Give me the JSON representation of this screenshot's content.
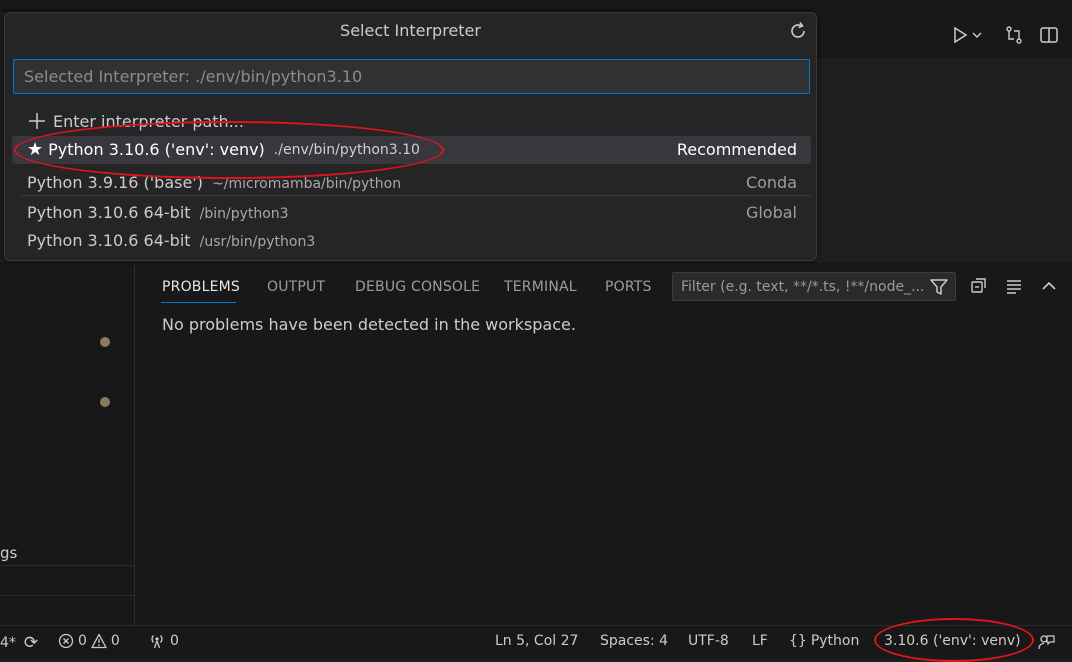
{
  "quick_pick": {
    "title": "Select Interpreter",
    "refresh_icon": "refresh-icon",
    "input_placeholder": "Selected Interpreter: ./env/bin/python3.10",
    "enter_path_label": "Enter interpreter path...",
    "items": [
      {
        "label": "Python 3.10.6 ('env': venv)",
        "description": "./env/bin/python3.10",
        "tag": "Recommended",
        "icon": "star-icon"
      },
      {
        "label": "Python 3.9.16 ('base')",
        "description": "~/micromamba/bin/python",
        "tag": "Conda"
      },
      {
        "label": "Python 3.10.6 64-bit",
        "description": "/bin/python3",
        "tag": "Global"
      },
      {
        "label": "Python 3.10.6 64-bit",
        "description": "/usr/bin/python3",
        "tag": ""
      }
    ]
  },
  "editor_toolbar": {
    "icons": [
      "run-icon",
      "chevron-down-icon",
      "compare-changes-icon",
      "split-editor-icon"
    ]
  },
  "sidebar": {
    "partial_text": "gs"
  },
  "panel": {
    "tabs": [
      "PROBLEMS",
      "OUTPUT",
      "DEBUG CONSOLE",
      "TERMINAL",
      "PORTS"
    ],
    "active_tab": "PROBLEMS",
    "filter_placeholder": "Filter (e.g. text, **/*.ts, !**/node_...",
    "message": "No problems have been detected in the workspace."
  },
  "status_bar": {
    "branch_fragment": "4*",
    "errors": "0",
    "warnings": "0",
    "ports": "0",
    "cursor": "Ln 5, Col 27",
    "spaces": "Spaces: 4",
    "encoding": "UTF-8",
    "eol": "LF",
    "language": "Python",
    "interpreter": "3.10.6 ('env': venv)"
  },
  "colors": {
    "accent": "#0078d4",
    "annotation": "#e0141e",
    "background": "#1f1f1f"
  }
}
